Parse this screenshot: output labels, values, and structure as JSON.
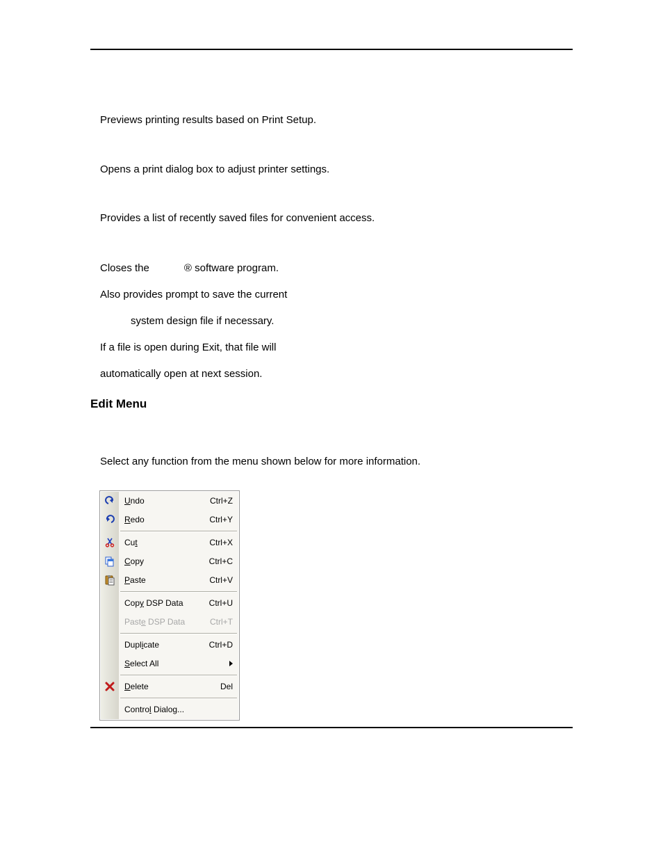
{
  "descriptions": {
    "print_preview": "Previews printing results based on Print Setup.",
    "print_setup": "Opens a print dialog box to adjust printer settings.",
    "recent_files": "Provides a list of recently saved files for convenient access.",
    "exit_line1_a": "Closes the ",
    "exit_line1_b": "® software program.",
    "exit_line2": "Also provides prompt to save the current",
    "exit_line3": "system design file if necessary.",
    "exit_line4": "If a file is open during Exit, that file will",
    "exit_line5": "automatically open at next session."
  },
  "section_heading": "Edit Menu",
  "instruction": "Select any function from the menu shown below for more information.",
  "menu": {
    "items": [
      {
        "icon": "undo",
        "pre": "",
        "hot": "U",
        "post": "ndo",
        "shortcut": "Ctrl+Z",
        "disabled": false,
        "submenu": false
      },
      {
        "icon": "redo",
        "pre": "",
        "hot": "R",
        "post": "edo",
        "shortcut": "Ctrl+Y",
        "disabled": false,
        "submenu": false
      },
      {
        "separator": true
      },
      {
        "icon": "cut",
        "pre": "Cu",
        "hot": "t",
        "post": "",
        "shortcut": "Ctrl+X",
        "disabled": false,
        "submenu": false
      },
      {
        "icon": "copy",
        "pre": "",
        "hot": "C",
        "post": "opy",
        "shortcut": "Ctrl+C",
        "disabled": false,
        "submenu": false
      },
      {
        "icon": "paste",
        "pre": "",
        "hot": "P",
        "post": "aste",
        "shortcut": "Ctrl+V",
        "disabled": false,
        "submenu": false
      },
      {
        "separator": true
      },
      {
        "icon": "",
        "pre": "Cop",
        "hot": "y",
        "post": " DSP Data",
        "shortcut": "Ctrl+U",
        "disabled": false,
        "submenu": false
      },
      {
        "icon": "",
        "pre": "Past",
        "hot": "e",
        "post": " DSP Data",
        "shortcut": "Ctrl+T",
        "disabled": true,
        "submenu": false
      },
      {
        "separator": true
      },
      {
        "icon": "",
        "pre": "Dupl",
        "hot": "i",
        "post": "cate",
        "shortcut": "Ctrl+D",
        "disabled": false,
        "submenu": false
      },
      {
        "icon": "",
        "pre": "",
        "hot": "S",
        "post": "elect All",
        "shortcut": "",
        "disabled": false,
        "submenu": true
      },
      {
        "separator": true
      },
      {
        "icon": "delete",
        "pre": "",
        "hot": "D",
        "post": "elete",
        "shortcut": "Del",
        "disabled": false,
        "submenu": false
      },
      {
        "separator": true
      },
      {
        "icon": "",
        "pre": "Contro",
        "hot": "l",
        "post": " Dialog...",
        "shortcut": "",
        "disabled": false,
        "submenu": false
      }
    ]
  }
}
